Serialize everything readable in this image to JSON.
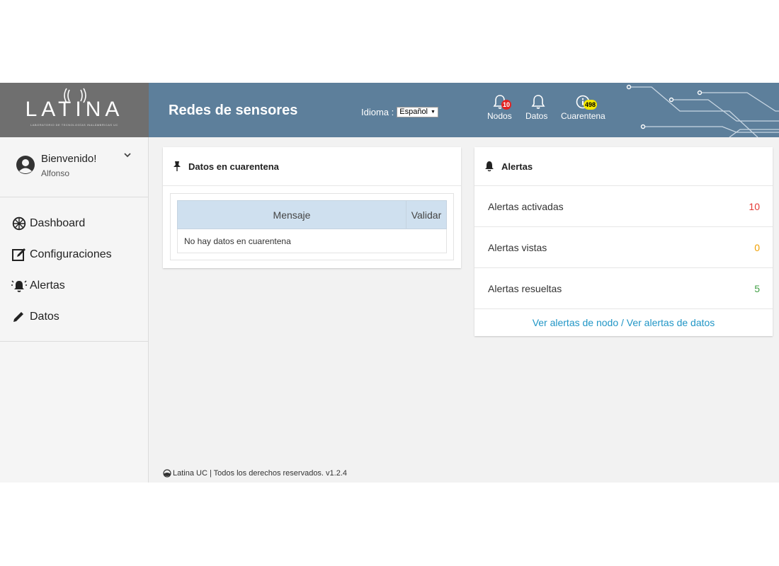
{
  "brand": {
    "logo_text": "LATINA",
    "logo_subtitle": "LABORATORIO DE TECNOLOGÍAS INALÁMBRICAS UC"
  },
  "navbar": {
    "title": "Redes de sensores",
    "language_label": "Idioma :",
    "language_value": "Español",
    "bells": [
      {
        "label": "Nodos",
        "badge": "10",
        "icon": "bell-icon",
        "badge_color": "#e32222"
      },
      {
        "label": "Datos",
        "badge": "",
        "icon": "bell-icon"
      },
      {
        "label": "Cuarentena",
        "badge": "498",
        "icon": "info-circle-icon",
        "badge_color": "#f3e800"
      }
    ]
  },
  "user": {
    "greeting": "Bienvenido!",
    "name": "Alfonso"
  },
  "sidebar": {
    "items": [
      {
        "label": "Dashboard",
        "icon": "dashboard-icon"
      },
      {
        "label": "Configuraciones",
        "icon": "edit-icon"
      },
      {
        "label": "Alertas",
        "icon": "alarm-icon"
      },
      {
        "label": "Datos",
        "icon": "pencil-icon"
      }
    ]
  },
  "quarantine": {
    "title": "Datos en cuarentena",
    "columns": [
      "Mensaje",
      "Validar"
    ],
    "empty_message": "No hay datos en cuarentena"
  },
  "alerts": {
    "title": "Alertas",
    "rows": [
      {
        "label": "Alertas activadas",
        "value": "10",
        "color": "#e53935"
      },
      {
        "label": "Alertas vistas",
        "value": "0",
        "color": "#f0a000"
      },
      {
        "label": "Alertas resueltas",
        "value": "5",
        "color": "#43a047"
      }
    ],
    "link_text": "Ver alertas de nodo / Ver alertas de datos"
  },
  "footer": {
    "text": "Latina UC | Todos los derechos reservados. v1.2.4"
  }
}
